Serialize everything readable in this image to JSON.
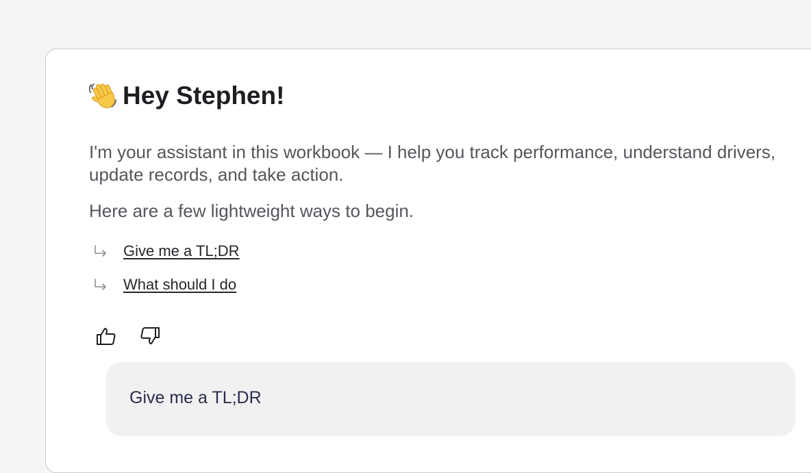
{
  "greeting": {
    "icon": "waving-hand-icon",
    "text": "Hey Stephen!"
  },
  "intro_text": "I'm your assistant in this workbook — I help you track performance, understand drivers, update records, and take action.",
  "lead_text": "Here are a few lightweight ways to begin.",
  "suggestions": [
    {
      "icon": "return-arrow-icon",
      "label": "Give me a TL;DR"
    },
    {
      "icon": "return-arrow-icon",
      "label": "What should I do"
    }
  ],
  "feedback": {
    "up_icon": "thumbs-up-icon",
    "down_icon": "thumbs-down-icon"
  },
  "user_message": {
    "text": "Give me a TL;DR"
  },
  "colors": {
    "page_background": "#f5f5f6",
    "panel_background": "#ffffff",
    "bubble_background": "#f1f1f2",
    "heading_text": "#1d1d22",
    "body_text": "#55565c",
    "bubble_text": "#2a2d4c"
  }
}
